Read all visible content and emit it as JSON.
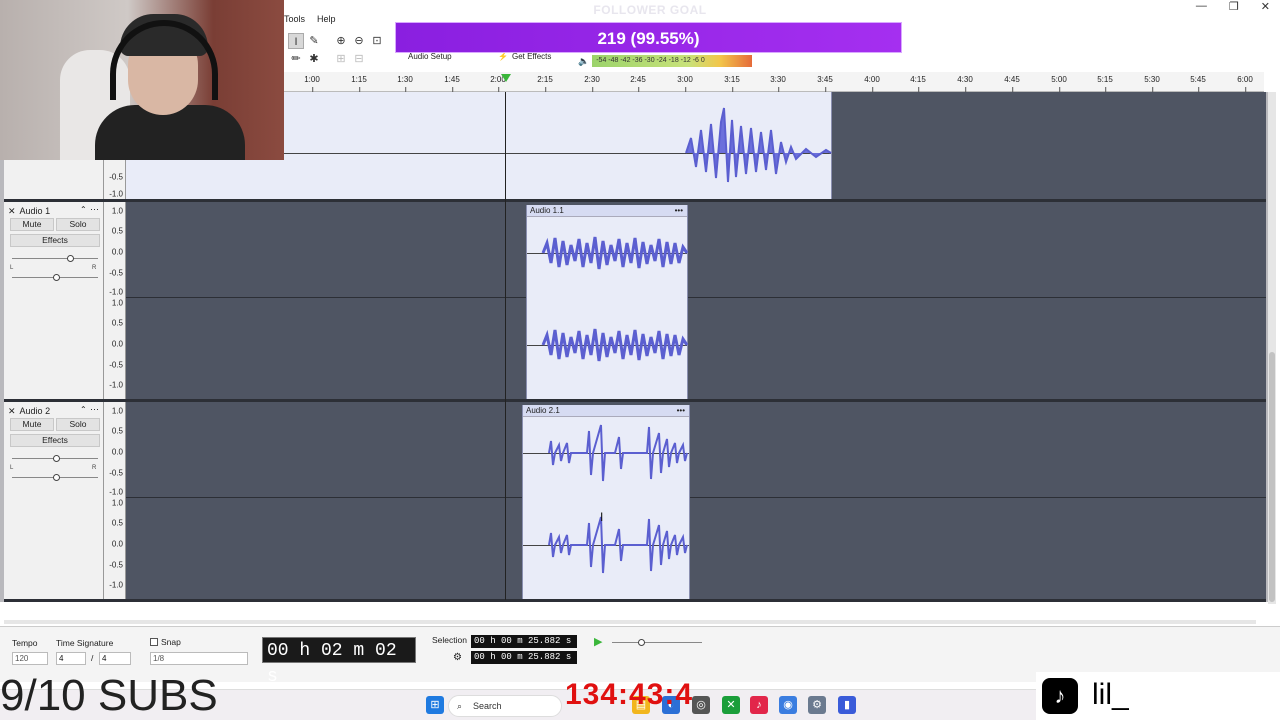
{
  "menu": {
    "tools": "Tools",
    "help": "Help"
  },
  "window_controls": {
    "minimize": "—",
    "maximize": "❐",
    "close": "✕"
  },
  "goal": {
    "title": "FOLLOWER GOAL",
    "value": "219 (99.55%)"
  },
  "toolbar": {
    "audio_setup": "Audio Setup",
    "get_effects": "Get Effects",
    "meter_text": "-54 -48 -42 -36 -30 -24 -18 -12 -6 0"
  },
  "ruler": {
    "labels": [
      "1:00",
      "1:15",
      "1:30",
      "1:45",
      "2:00",
      "2:15",
      "2:30",
      "2:45",
      "3:00",
      "3:15",
      "3:30",
      "3:45",
      "4:00",
      "4:15",
      "4:30",
      "4:45",
      "5:00",
      "5:15",
      "5:30",
      "5:45",
      "6:00"
    ]
  },
  "scale": {
    "top": "1.0",
    "upper": "0.5",
    "mid": "0.0",
    "lower": "-0.5",
    "bottom": "-1.0"
  },
  "tracks": [
    {
      "name": "Audio 1",
      "mute": "Mute",
      "solo": "Solo",
      "effects": "Effects",
      "clip": "Audio 1.1",
      "pan_left": "L",
      "pan_right": "R"
    },
    {
      "name": "Audio 2",
      "mute": "Mute",
      "solo": "Solo",
      "effects": "Effects",
      "clip": "Audio 2.1",
      "pan_left": "L",
      "pan_right": "R"
    }
  ],
  "bottom": {
    "tempo_label": "Tempo",
    "tempo_value": "120",
    "timesig_label": "Time Signature",
    "timesig_num": "4",
    "timesig_den": "4",
    "snap_label": "Snap",
    "snap_value": "1/8",
    "time_display": "00 h 02 m 02 s",
    "selection_label": "Selection",
    "selection_start": "00 h 00 m 25.882 s",
    "selection_end": "00 h 00 m 25.882 s"
  },
  "overlay": {
    "subs": "9/10 SUBS",
    "timer": "134:43:4",
    "tiktok_handle": "lil_",
    "search": "Search"
  },
  "colors": {
    "goal_bar": "#9b27ea",
    "waveform": "#5b5fd0",
    "track_bg": "#4f5563",
    "clip_bg": "#e9ecf8"
  }
}
